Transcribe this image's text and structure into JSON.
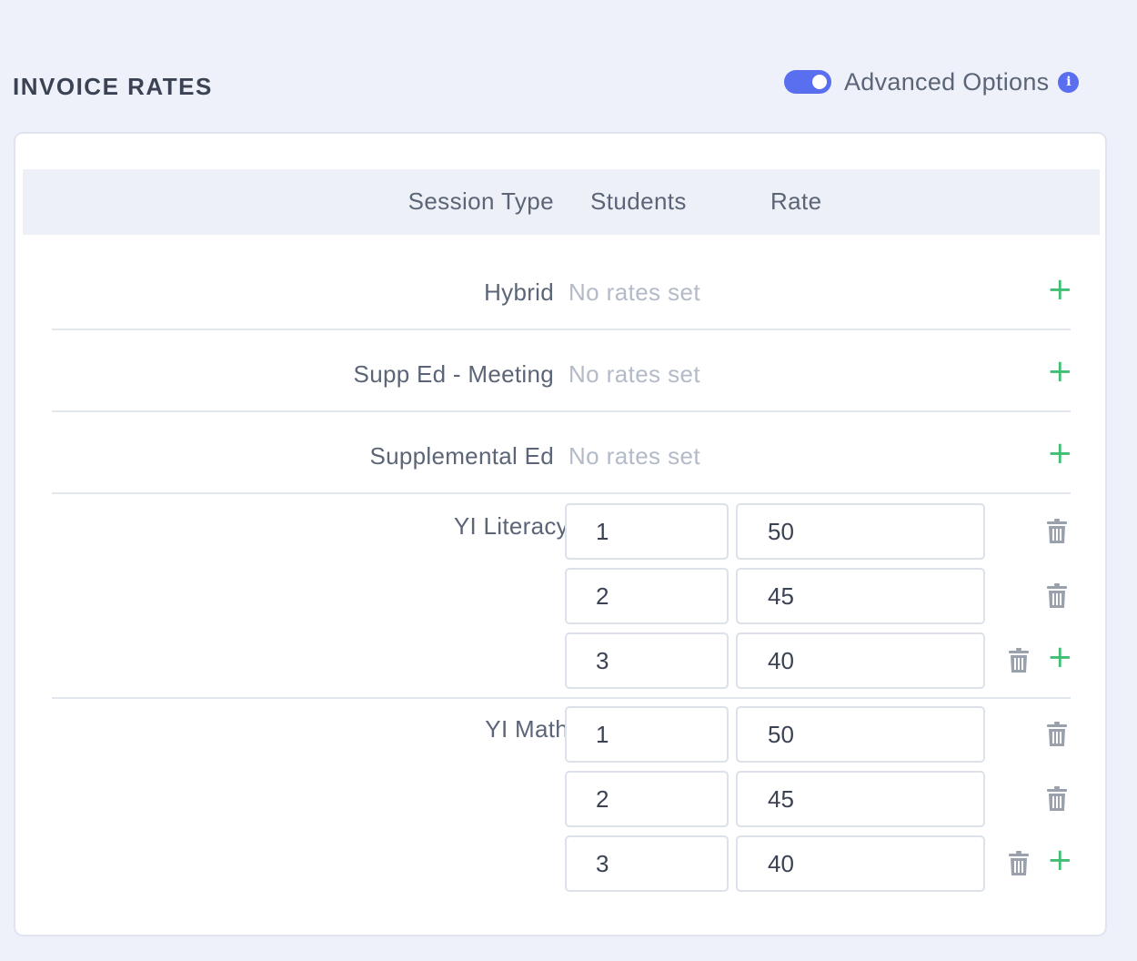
{
  "header": {
    "title": "INVOICE RATES"
  },
  "advanced": {
    "label": "Advanced Options",
    "enabled": true,
    "info_glyph": "i"
  },
  "table": {
    "headers": {
      "session_type": "Session Type",
      "students": "Students",
      "rate": "Rate"
    },
    "empty_rows": [
      {
        "session_type": "Hybrid",
        "status": "No rates set",
        "add_glyph": "+"
      },
      {
        "session_type": "Supp Ed - Meeting",
        "status": "No rates set",
        "add_glyph": "+"
      },
      {
        "session_type": "Supplemental Ed",
        "status": "No rates set",
        "add_glyph": "+"
      }
    ],
    "groups": [
      {
        "session_type": "YI Literacy",
        "rates": [
          {
            "students": "1",
            "rate": "50"
          },
          {
            "students": "2",
            "rate": "45"
          },
          {
            "students": "3",
            "rate": "40"
          }
        ],
        "add_glyph": "+"
      },
      {
        "session_type": "YI Math",
        "rates": [
          {
            "students": "1",
            "rate": "50"
          },
          {
            "students": "2",
            "rate": "45"
          },
          {
            "students": "3",
            "rate": "40"
          }
        ],
        "add_glyph": "+"
      }
    ]
  },
  "colors": {
    "accent": "#5a6ef0",
    "add": "#3fbf73",
    "trash": "#9aa1ad",
    "muted": "#b3bac8",
    "background": "#eef1f9"
  },
  "icons": {
    "trash": "trash-icon",
    "add": "plus-icon",
    "info": "info-icon"
  }
}
